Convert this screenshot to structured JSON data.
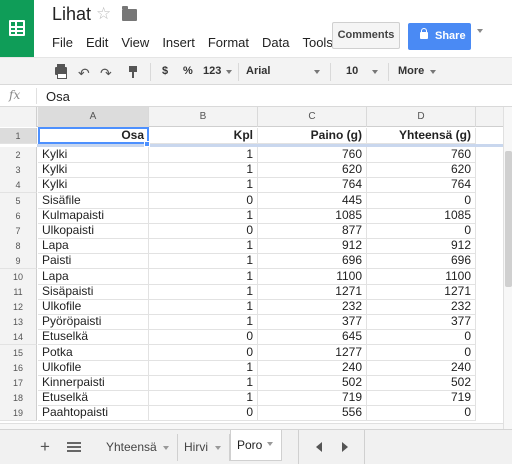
{
  "app": {
    "title": "Lihat",
    "menu": [
      "File",
      "Edit",
      "View",
      "Insert",
      "Format",
      "Data",
      "Tools"
    ],
    "comments_label": "Comments",
    "share_label": "Share"
  },
  "toolbar": {
    "currency": "$",
    "percent": "%",
    "number_format": "123",
    "font": "Arial",
    "font_size": "10",
    "more": "More"
  },
  "formula_bar": {
    "fx": "fx",
    "value": "Osa"
  },
  "grid": {
    "columns": [
      "A",
      "B",
      "C",
      "D"
    ],
    "rows": [
      {
        "n": "1",
        "a": "Osa",
        "b": "Kpl",
        "c": "Paino (g)",
        "d": "Yhteensä (g)"
      },
      {
        "n": "2",
        "a": "Kylki",
        "b": "1",
        "c": "760",
        "d": "760"
      },
      {
        "n": "3",
        "a": "Kylki",
        "b": "1",
        "c": "620",
        "d": "620"
      },
      {
        "n": "4",
        "a": "Kylki",
        "b": "1",
        "c": "764",
        "d": "764"
      },
      {
        "n": "5",
        "a": "Sisäfile",
        "b": "0",
        "c": "445",
        "d": "0"
      },
      {
        "n": "6",
        "a": "Kulmapaisti",
        "b": "1",
        "c": "1085",
        "d": "1085"
      },
      {
        "n": "7",
        "a": "Ulkopaisti",
        "b": "0",
        "c": "877",
        "d": "0"
      },
      {
        "n": "8",
        "a": "Lapa",
        "b": "1",
        "c": "912",
        "d": "912"
      },
      {
        "n": "9",
        "a": "Paisti",
        "b": "1",
        "c": "696",
        "d": "696"
      },
      {
        "n": "10",
        "a": "Lapa",
        "b": "1",
        "c": "1100",
        "d": "1100"
      },
      {
        "n": "11",
        "a": "Sisäpaisti",
        "b": "1",
        "c": "1271",
        "d": "1271"
      },
      {
        "n": "12",
        "a": "Ulkofile",
        "b": "1",
        "c": "232",
        "d": "232"
      },
      {
        "n": "13",
        "a": "Pyöröpaisti",
        "b": "1",
        "c": "377",
        "d": "377"
      },
      {
        "n": "14",
        "a": "Etuselkä",
        "b": "0",
        "c": "645",
        "d": "0"
      },
      {
        "n": "15",
        "a": "Potka",
        "b": "0",
        "c": "1277",
        "d": "0"
      },
      {
        "n": "16",
        "a": "Ulkofile",
        "b": "1",
        "c": "240",
        "d": "240"
      },
      {
        "n": "17",
        "a": "Kinnerpaisti",
        "b": "1",
        "c": "502",
        "d": "502"
      },
      {
        "n": "18",
        "a": "Etuselkä",
        "b": "1",
        "c": "719",
        "d": "719"
      },
      {
        "n": "19",
        "a": "Paahtopaisti",
        "b": "0",
        "c": "556",
        "d": "0"
      }
    ]
  },
  "sheets": {
    "tabs": [
      "Yhteensä",
      "Hirvi",
      "Poro"
    ],
    "active": "Poro"
  }
}
